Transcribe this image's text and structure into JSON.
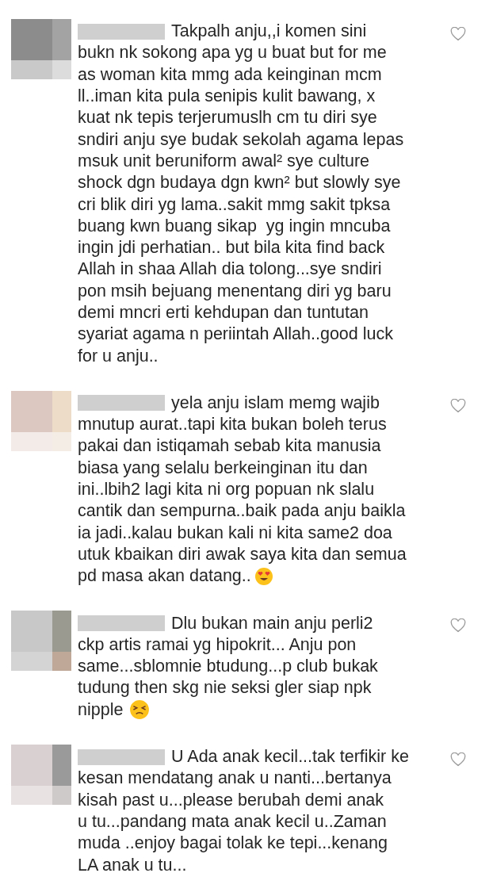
{
  "comments": [
    {
      "kind": "plain",
      "username_hidden": true,
      "lines": [
        "Takpalh anju,,i komen sini",
        "bukn nk sokong apa yg u buat but for me",
        "as woman kita mmg ada keinginan mcm",
        "ll..iman kita pula senipis kulit bawang, x",
        "kuat nk tepis terjerumuslh cm tu diri sye",
        "sndiri anju sye budak sekolah agama lepas",
        "msuk unit beruniform awal² sye culture",
        "shock dgn budaya dgn kwn² but slowly sye",
        "cri blik diri yg lama..sakit mmg sakit tpksa",
        "buang kwn buang sikap  yg ingin mncuba",
        "ingin jdi perhatian.. but bila kita find back",
        "Allah in shaa Allah dia tolong...sye sndiri",
        "pon msih bejuang menentang diri yg baru",
        "demi mncri erti kehdupan dan tuntutan",
        "syariat agama n periintah Allah..good luck",
        "for u anju.."
      ],
      "liked": false
    },
    {
      "kind": "hearteyes",
      "username_hidden": true,
      "lines": [
        "yela anju islam memg wajib",
        "mnutup aurat..tapi kita bukan boleh terus",
        "pakai dan istiqamah sebab kita manusia",
        "biasa yang selalu berkeinginan itu dan",
        "ini..lbih2 lagi kita ni org popuan nk slalu",
        "cantik dan sempurna..baik pada anju baikla",
        "ia jadi..kalau bukan kali ni kita same2 doa",
        "utuk kbaikan diri awak saya kita dan semua",
        "pd masa akan datang.."
      ],
      "liked": false
    },
    {
      "kind": "persevering",
      "username_hidden": true,
      "lines": [
        "Dlu bukan main anju perli2",
        "ckp artis ramai yg hipokrit... Anju pon",
        "same...sblomnie btudung...p club bukak",
        "tudung then skg nie seksi gler siap npk",
        "nipple"
      ],
      "liked": false
    },
    {
      "kind": "plain",
      "username_hidden": true,
      "lines": [
        "U Ada anak kecil...tak terfikir ke",
        "kesan mendatang anak u nanti...bertanya",
        "kisah past u...please berubah demi anak",
        "u tu...pandang mata anak kecil u..Zaman",
        "muda ..enjoy bagai tolak ke tepi...kenang",
        "LA anak u tu..."
      ],
      "liked": false
    }
  ]
}
